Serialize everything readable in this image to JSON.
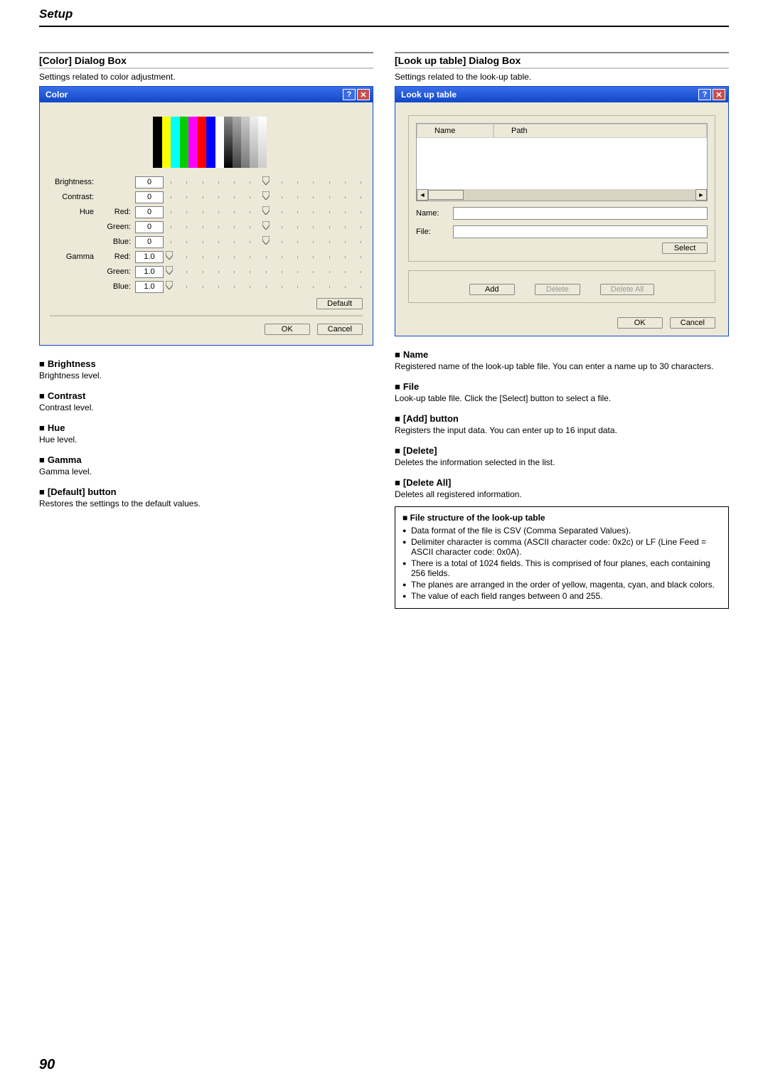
{
  "page_header": "Setup",
  "page_number": "90",
  "left": {
    "title": "[Color] Dialog Box",
    "desc": "Settings related to color adjustment.",
    "dialog_title": "Color",
    "rows": {
      "brightness": {
        "label": "Brightness:",
        "val": "0"
      },
      "contrast": {
        "label": "Contrast:",
        "val": "0"
      },
      "hue_group": {
        "label": "Hue",
        "red": {
          "label": "Red:",
          "val": "0"
        },
        "green": {
          "label": "Green:",
          "val": "0"
        },
        "blue": {
          "label": "Blue:",
          "val": "0"
        }
      },
      "gamma_group": {
        "label": "Gamma",
        "red": {
          "label": "Red:",
          "val": "1.0"
        },
        "green": {
          "label": "Green:",
          "val": "1.0"
        },
        "blue": {
          "label": "Blue:",
          "val": "1.0"
        }
      }
    },
    "default_btn": "Default",
    "ok": "OK",
    "cancel": "Cancel",
    "items": [
      {
        "t": "Brightness",
        "d": "Brightness level."
      },
      {
        "t": "Contrast",
        "d": "Contrast level."
      },
      {
        "t": "Hue",
        "d": "Hue level."
      },
      {
        "t": "Gamma",
        "d": "Gamma level."
      },
      {
        "t": "[Default] button",
        "d": "Restores the settings to the default values."
      }
    ]
  },
  "right": {
    "title": "[Look up table] Dialog Box",
    "desc": "Settings related to the look-up table.",
    "dialog_title": "Look up table",
    "list": {
      "col1": "Name",
      "col2": "Path"
    },
    "name_label": "Name:",
    "file_label": "File:",
    "select": "Select",
    "add": "Add",
    "delete": "Delete",
    "delete_all": "Delete All",
    "ok": "OK",
    "cancel": "Cancel",
    "items": [
      {
        "t": "Name",
        "d": "Registered name of the look-up table file. You can enter a name up to 30 characters."
      },
      {
        "t": "File",
        "d": "Look-up table file. Click the [Select] button to select a file."
      },
      {
        "t": "[Add] button",
        "d": "Registers the input data. You can enter up to 16 input data."
      },
      {
        "t": "[Delete]",
        "d": "Deletes the information selected in the list."
      },
      {
        "t": "[Delete All]",
        "d": "Deletes all registered information."
      }
    ],
    "note": {
      "title": "■ File structure of the look-up table",
      "bullets": [
        "Data format of the file is CSV (Comma Separated Values).",
        "Delimiter character is comma (ASCII character code: 0x2c) or LF (Line Feed = ASCII character code: 0x0A).",
        "There is a total of 1024 fields. This is comprised of four planes, each containing 256 fields.",
        "The planes are arranged in the order of yellow, magenta, cyan, and black colors.",
        "The value of each field ranges between 0 and 255."
      ]
    }
  }
}
